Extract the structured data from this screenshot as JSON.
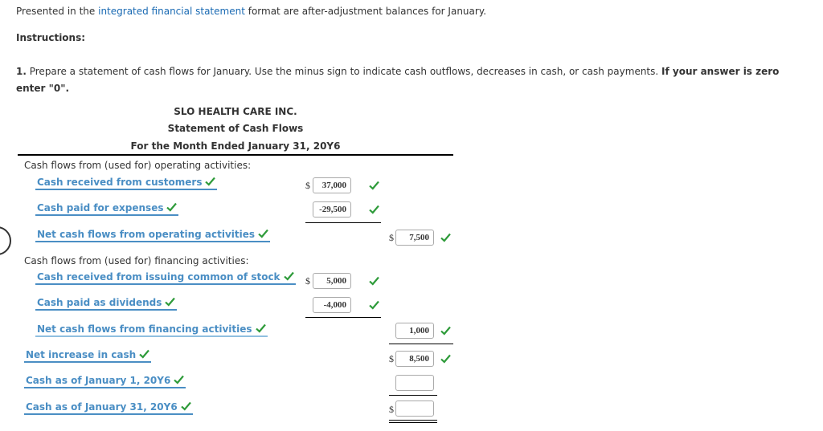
{
  "intro": {
    "before": "Presented in the ",
    "link": "integrated financial statement",
    "after": " format are after-adjustment balances for January."
  },
  "instructions_heading": "Instructions:",
  "question": {
    "number": "1.",
    "text": " Prepare a statement of cash flows for January. Use the minus sign to indicate cash outflows, decreases in cash, or cash payments. ",
    "bold_text": "If your answer is zero enter \"0\"."
  },
  "statement": {
    "company": "SLO HEALTH CARE INC.",
    "title": "Statement of Cash Flows",
    "period": "For the Month Ended January 31, 20Y6",
    "currency_symbol": "$",
    "operating_heading": "Cash flows from (used for) operating activities:",
    "financing_heading": "Cash flows from (used for) financing activities:",
    "rows": [
      {
        "label": "Cash received from customers",
        "correct": true,
        "value": "37,000",
        "value_correct": true
      },
      {
        "label": "Cash paid for expenses",
        "correct": true,
        "value": "-29,500",
        "value_correct": true
      },
      {
        "label": "Net cash flows from operating activities",
        "correct": true,
        "value": "7,500",
        "value_correct": true
      },
      {
        "label": "Cash received from issuing common of stock",
        "correct": true,
        "value": "5,000",
        "value_correct": true
      },
      {
        "label": "Cash paid as dividends",
        "correct": true,
        "value": "-4,000",
        "value_correct": true
      },
      {
        "label": "Net cash flows from financing activities",
        "correct": true,
        "value": "1,000",
        "value_correct": true
      },
      {
        "label": "Net increase in cash",
        "correct": true,
        "value": "8,500",
        "value_correct": true
      },
      {
        "label": "Cash as of January 1, 20Y6",
        "correct": true,
        "value": "",
        "value_correct": false
      },
      {
        "label": "Cash as of January 31, 20Y6",
        "correct": true,
        "value": "",
        "value_correct": false
      }
    ]
  },
  "colors": {
    "link": "#1a6ab3",
    "account_label": "#4a8ec4",
    "check": "#2e9b3a"
  }
}
